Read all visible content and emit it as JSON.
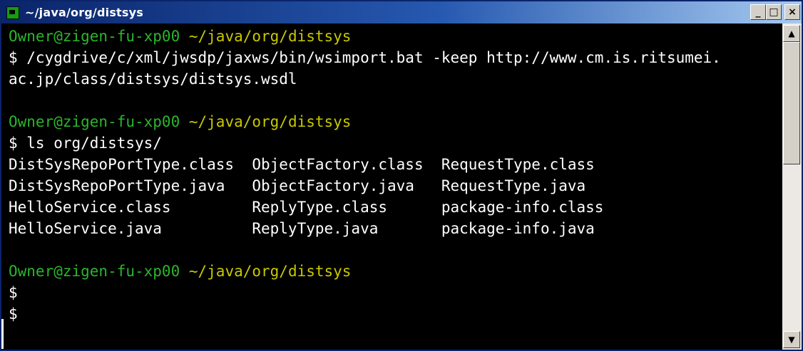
{
  "window": {
    "title": "~/java/org/distsys"
  },
  "controls": {
    "minimize": "_",
    "maximize": "□",
    "close": "×"
  },
  "terminal": {
    "lines": [
      {
        "prompt": "Owner@zigen-fu-xp00",
        "path": "~/java/org/distsys"
      },
      {
        "text": "$ /cygdrive/c/xml/jwsdp/jaxws/bin/wsimport.bat -keep http://www.cm.is.ritsumei."
      },
      {
        "text": "ac.jp/class/distsys/distsys.wsdl"
      },
      {
        "text": ""
      },
      {
        "prompt": "Owner@zigen-fu-xp00",
        "path": "~/java/org/distsys"
      },
      {
        "text": "$ ls org/distsys/"
      },
      {
        "text": "DistSysRepoPortType.class  ObjectFactory.class  RequestType.class"
      },
      {
        "text": "DistSysRepoPortType.java   ObjectFactory.java   RequestType.java"
      },
      {
        "text": "HelloService.class         ReplyType.class      package-info.class"
      },
      {
        "text": "HelloService.java          ReplyType.java       package-info.java"
      },
      {
        "text": ""
      },
      {
        "prompt": "Owner@zigen-fu-xp00",
        "path": "~/java/org/distsys"
      },
      {
        "text": "$"
      },
      {
        "text": "$"
      }
    ]
  },
  "scrollbar": {
    "up": "▲",
    "down": "▼"
  },
  "colors": {
    "prompt": "#2cb52c",
    "path": "#c8c800",
    "text": "#ffffff",
    "background": "#000000"
  }
}
